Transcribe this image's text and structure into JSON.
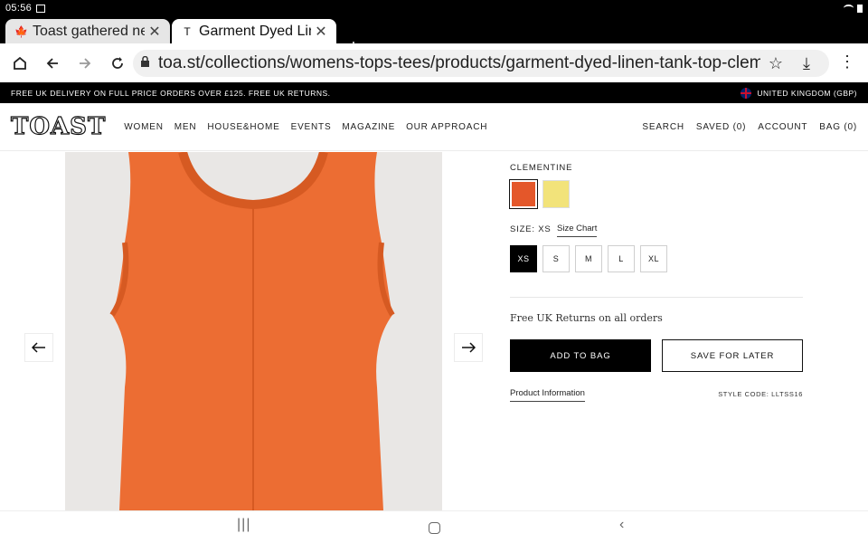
{
  "status_bar": {
    "time": "05:56"
  },
  "tabs": [
    {
      "favicon": "🍁",
      "title": "Toast gathered nec",
      "close": "✕"
    },
    {
      "favicon": "T",
      "title": "Garment Dyed Liner",
      "close": "✕"
    }
  ],
  "new_tab_label": "+",
  "toolbar": {
    "url": "toa.st/collections/womens-tops-tees/products/garment-dyed-linen-tank-top-cleme",
    "icons": {
      "home": "home-icon",
      "back": "back-arrow-icon",
      "forward": "forward-arrow-icon",
      "reload": "reload-icon"
    }
  },
  "promo": {
    "message": "FREE UK DELIVERY ON FULL PRICE ORDERS OVER £125. FREE UK RETURNS.",
    "region": "UNITED KINGDOM (GBP)"
  },
  "header": {
    "logo": "TOAST",
    "nav": [
      "WOMEN",
      "MEN",
      "HOUSE&HOME",
      "EVENTS",
      "MAGAZINE",
      "OUR APPROACH"
    ],
    "utility": [
      "SEARCH",
      "SAVED (0)",
      "ACCOUNT",
      "BAG (0)"
    ]
  },
  "product": {
    "color_name": "CLEMENTINE",
    "swatches": [
      {
        "name": "clementine",
        "color": "#e4572a"
      },
      {
        "name": "yellow",
        "color": "#f2e37a"
      }
    ],
    "size_label": "SIZE: XS",
    "size_chart": "Size Chart",
    "sizes": [
      "XS",
      "S",
      "M",
      "L",
      "XL"
    ],
    "selected_size": "XS",
    "returns": "Free UK Returns on all orders",
    "add_to_bag": "ADD TO BAG",
    "save_for_later": "SAVE FOR LATER",
    "product_information": "Product Information",
    "style_code": "STYLE CODE: LLTSS16",
    "garment_color": "#ec6d33"
  }
}
